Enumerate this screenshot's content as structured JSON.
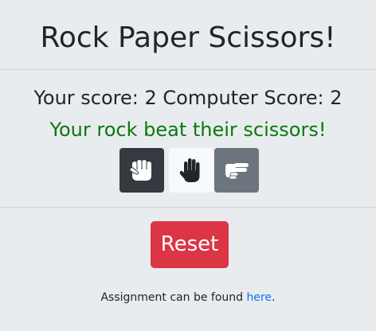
{
  "title": "Rock Paper Scissors!",
  "score": {
    "text": "Your score: 2 Computer Score: 2",
    "player": 2,
    "computer": 2
  },
  "result": {
    "text": "Your rock beat their scissors!",
    "color": "#0a7a0a"
  },
  "choices": [
    {
      "name": "rock",
      "icon": "fist-icon",
      "background": "#343a40"
    },
    {
      "name": "paper",
      "icon": "open-hand-icon",
      "background": "#f8f9fa"
    },
    {
      "name": "scissors",
      "icon": "peace-hand-icon",
      "background": "#6c757d"
    }
  ],
  "reset": {
    "label": "Reset",
    "color": "#dc3545"
  },
  "footer": {
    "text": "Assignment can be found ",
    "link_text": "here",
    "suffix": ".",
    "link_color": "#0d6efd"
  }
}
